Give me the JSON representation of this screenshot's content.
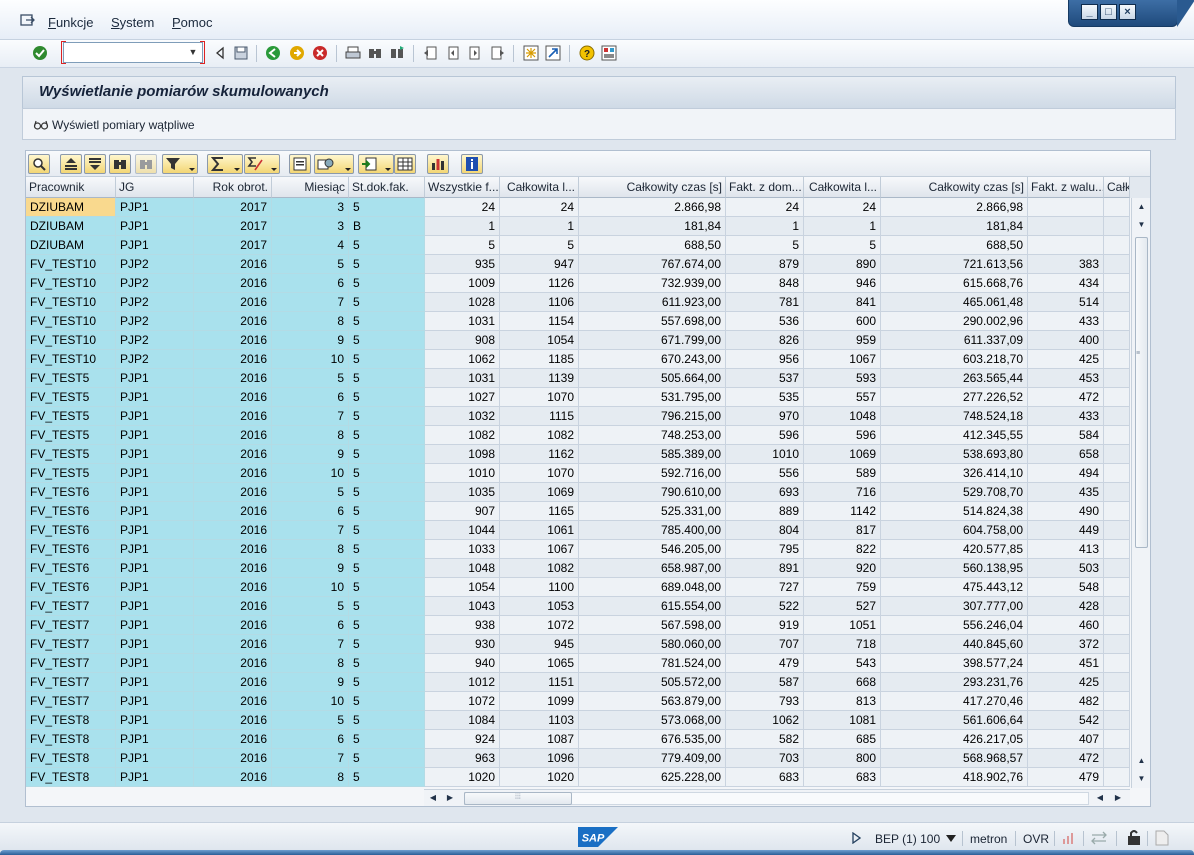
{
  "menu": {
    "items": [
      {
        "label_first": "F",
        "label_rest": "unkcje"
      },
      {
        "label_first": "S",
        "label_rest": "ystem"
      },
      {
        "label_first": "P",
        "label_rest": "omoc"
      }
    ]
  },
  "window_controls": {
    "minimize": "_",
    "maximize": "□",
    "close": "×"
  },
  "command_field": {
    "value": ""
  },
  "page": {
    "title": "Wyświetlanie pomiarów skumulowanych",
    "app_button_label": "Wyświetl pomiary wątpliwe"
  },
  "table": {
    "headers": [
      "Pracownik",
      "JG",
      "Rok obrot.",
      "Miesiąc",
      "St.dok.fak.",
      "Wszystkie f...",
      "Całkowita l...",
      "Całkowity czas [s]",
      "Fakt. z dom...",
      "Całkowita l...",
      "Całkowity czas [s]",
      "Fakt. z walu...",
      "Całk"
    ],
    "rows": [
      [
        "DZIUBAM",
        "PJP1",
        "2017",
        "3",
        "5",
        "24",
        "24",
        "2.866,98",
        "24",
        "24",
        "2.866,98",
        "",
        ""
      ],
      [
        "DZIUBAM",
        "PJP1",
        "2017",
        "3",
        "B",
        "1",
        "1",
        "181,84",
        "1",
        "1",
        "181,84",
        "",
        ""
      ],
      [
        "DZIUBAM",
        "PJP1",
        "2017",
        "4",
        "5",
        "5",
        "5",
        "688,50",
        "5",
        "5",
        "688,50",
        "",
        ""
      ],
      [
        "FV_TEST10",
        "PJP2",
        "2016",
        "5",
        "5",
        "935",
        "947",
        "767.674,00",
        "879",
        "890",
        "721.613,56",
        "383",
        ""
      ],
      [
        "FV_TEST10",
        "PJP2",
        "2016",
        "6",
        "5",
        "1009",
        "1126",
        "732.939,00",
        "848",
        "946",
        "615.668,76",
        "434",
        ""
      ],
      [
        "FV_TEST10",
        "PJP2",
        "2016",
        "7",
        "5",
        "1028",
        "1106",
        "611.923,00",
        "781",
        "841",
        "465.061,48",
        "514",
        ""
      ],
      [
        "FV_TEST10",
        "PJP2",
        "2016",
        "8",
        "5",
        "1031",
        "1154",
        "557.698,00",
        "536",
        "600",
        "290.002,96",
        "433",
        ""
      ],
      [
        "FV_TEST10",
        "PJP2",
        "2016",
        "9",
        "5",
        "908",
        "1054",
        "671.799,00",
        "826",
        "959",
        "611.337,09",
        "400",
        ""
      ],
      [
        "FV_TEST10",
        "PJP2",
        "2016",
        "10",
        "5",
        "1062",
        "1185",
        "670.243,00",
        "956",
        "1067",
        "603.218,70",
        "425",
        ""
      ],
      [
        "FV_TEST5",
        "PJP1",
        "2016",
        "5",
        "5",
        "1031",
        "1139",
        "505.664,00",
        "537",
        "593",
        "263.565,44",
        "453",
        ""
      ],
      [
        "FV_TEST5",
        "PJP1",
        "2016",
        "6",
        "5",
        "1027",
        "1070",
        "531.795,00",
        "535",
        "557",
        "277.226,52",
        "472",
        ""
      ],
      [
        "FV_TEST5",
        "PJP1",
        "2016",
        "7",
        "5",
        "1032",
        "1115",
        "796.215,00",
        "970",
        "1048",
        "748.524,18",
        "433",
        ""
      ],
      [
        "FV_TEST5",
        "PJP1",
        "2016",
        "8",
        "5",
        "1082",
        "1082",
        "748.253,00",
        "596",
        "596",
        "412.345,55",
        "584",
        ""
      ],
      [
        "FV_TEST5",
        "PJP1",
        "2016",
        "9",
        "5",
        "1098",
        "1162",
        "585.389,00",
        "1010",
        "1069",
        "538.693,80",
        "658",
        ""
      ],
      [
        "FV_TEST5",
        "PJP1",
        "2016",
        "10",
        "5",
        "1010",
        "1070",
        "592.716,00",
        "556",
        "589",
        "326.414,10",
        "494",
        ""
      ],
      [
        "FV_TEST6",
        "PJP1",
        "2016",
        "5",
        "5",
        "1035",
        "1069",
        "790.610,00",
        "693",
        "716",
        "529.708,70",
        "435",
        ""
      ],
      [
        "FV_TEST6",
        "PJP1",
        "2016",
        "6",
        "5",
        "907",
        "1165",
        "525.331,00",
        "889",
        "1142",
        "514.824,38",
        "490",
        ""
      ],
      [
        "FV_TEST6",
        "PJP1",
        "2016",
        "7",
        "5",
        "1044",
        "1061",
        "785.400,00",
        "804",
        "817",
        "604.758,00",
        "449",
        ""
      ],
      [
        "FV_TEST6",
        "PJP1",
        "2016",
        "8",
        "5",
        "1033",
        "1067",
        "546.205,00",
        "795",
        "822",
        "420.577,85",
        "413",
        ""
      ],
      [
        "FV_TEST6",
        "PJP1",
        "2016",
        "9",
        "5",
        "1048",
        "1082",
        "658.987,00",
        "891",
        "920",
        "560.138,95",
        "503",
        ""
      ],
      [
        "FV_TEST6",
        "PJP1",
        "2016",
        "10",
        "5",
        "1054",
        "1100",
        "689.048,00",
        "727",
        "759",
        "475.443,12",
        "548",
        ""
      ],
      [
        "FV_TEST7",
        "PJP1",
        "2016",
        "5",
        "5",
        "1043",
        "1053",
        "615.554,00",
        "522",
        "527",
        "307.777,00",
        "428",
        ""
      ],
      [
        "FV_TEST7",
        "PJP1",
        "2016",
        "6",
        "5",
        "938",
        "1072",
        "567.598,00",
        "919",
        "1051",
        "556.246,04",
        "460",
        ""
      ],
      [
        "FV_TEST7",
        "PJP1",
        "2016",
        "7",
        "5",
        "930",
        "945",
        "580.060,00",
        "707",
        "718",
        "440.845,60",
        "372",
        ""
      ],
      [
        "FV_TEST7",
        "PJP1",
        "2016",
        "8",
        "5",
        "940",
        "1065",
        "781.524,00",
        "479",
        "543",
        "398.577,24",
        "451",
        ""
      ],
      [
        "FV_TEST7",
        "PJP1",
        "2016",
        "9",
        "5",
        "1012",
        "1151",
        "505.572,00",
        "587",
        "668",
        "293.231,76",
        "425",
        ""
      ],
      [
        "FV_TEST7",
        "PJP1",
        "2016",
        "10",
        "5",
        "1072",
        "1099",
        "563.879,00",
        "793",
        "813",
        "417.270,46",
        "482",
        ""
      ],
      [
        "FV_TEST8",
        "PJP1",
        "2016",
        "5",
        "5",
        "1084",
        "1103",
        "573.068,00",
        "1062",
        "1081",
        "561.606,64",
        "542",
        ""
      ],
      [
        "FV_TEST8",
        "PJP1",
        "2016",
        "6",
        "5",
        "924",
        "1087",
        "676.535,00",
        "582",
        "685",
        "426.217,05",
        "407",
        ""
      ],
      [
        "FV_TEST8",
        "PJP1",
        "2016",
        "7",
        "5",
        "963",
        "1096",
        "779.409,00",
        "703",
        "800",
        "568.968,57",
        "472",
        ""
      ],
      [
        "FV_TEST8",
        "PJP1",
        "2016",
        "8",
        "5",
        "1020",
        "1020",
        "625.228,00",
        "683",
        "683",
        "418.902,76",
        "479",
        ""
      ]
    ],
    "selected_row": 0
  },
  "status": {
    "system": "BEP (1) 100",
    "user": "metron",
    "mode": "OVR"
  },
  "colors": {
    "key_column": "#a9e1ed",
    "selected_cell": "#f9d98e",
    "sap_blue": "#1a6fc4"
  },
  "icons": [
    "menu-icon",
    "enter-icon",
    "back-icon",
    "save-icon",
    "green-back-icon",
    "exit-icon",
    "cancel-icon",
    "print-icon",
    "find-icon",
    "find-next-icon",
    "first-page-icon",
    "previous-page-icon",
    "next-page-icon",
    "last-page-icon",
    "new-session-icon",
    "shortcut-icon",
    "help-icon",
    "layout-icon"
  ]
}
